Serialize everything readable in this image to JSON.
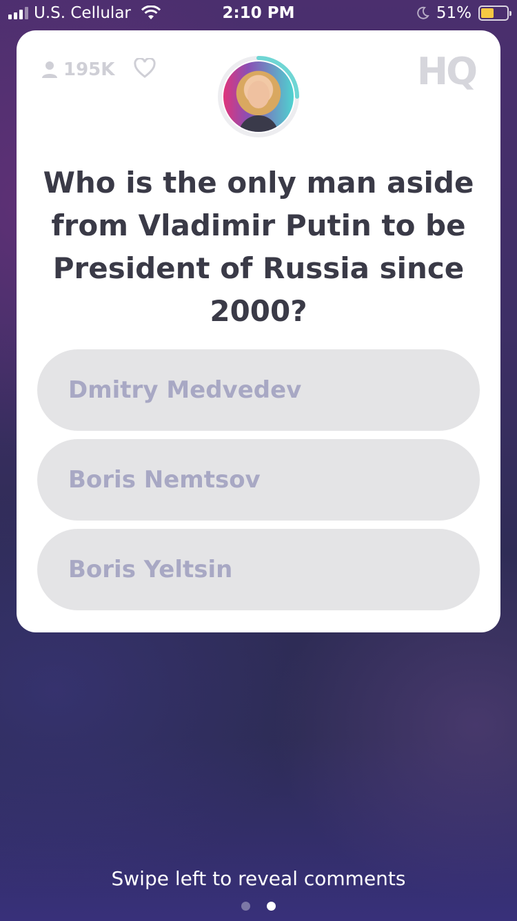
{
  "status_bar": {
    "carrier": "U.S. Cellular",
    "time": "2:10 PM",
    "battery_percent": "51%",
    "battery_level": 0.51,
    "icons": [
      "signal-icon",
      "wifi-icon",
      "moon-icon",
      "battery-icon"
    ]
  },
  "header": {
    "viewer_count": "195K",
    "logo": "HQ"
  },
  "question": {
    "text": "Who is the only man aside from Vladimir Putin to be President of Russia since 2000?"
  },
  "answers": [
    {
      "label": "Dmitry Medvedev"
    },
    {
      "label": "Boris Nemtsov"
    },
    {
      "label": "Boris Yeltsin"
    }
  ],
  "footer": {
    "swipe_hint": "Swipe left to reveal comments",
    "page_count": 2,
    "active_page": 2
  },
  "colors": {
    "card_bg": "#ffffff",
    "answer_bg": "#e4e4e6",
    "answer_text": "#a8a8c4",
    "question_text": "#3a3a47",
    "timer_ring": "#6fd6d4",
    "battery": "#f5c842"
  }
}
